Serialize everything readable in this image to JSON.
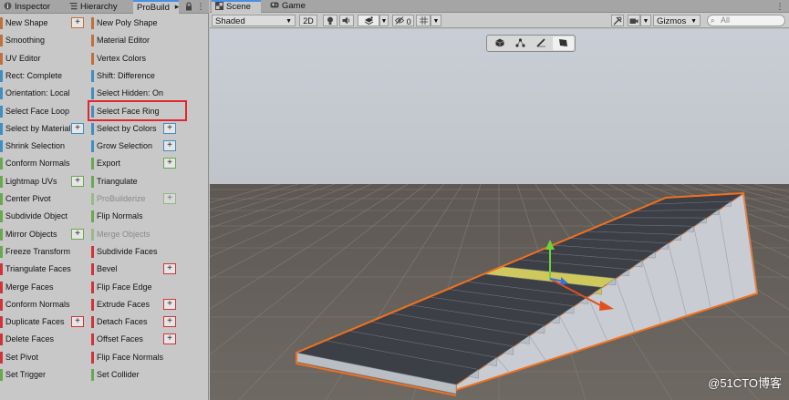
{
  "left_tabs": [
    {
      "label": "Inspector"
    },
    {
      "label": "Hierarchy"
    },
    {
      "label": "ProBuild"
    }
  ],
  "probuilder": {
    "left_column": [
      {
        "label": "New Shape",
        "color": "#c0703a",
        "plus": true
      },
      {
        "label": "Smoothing",
        "color": "#c0703a",
        "plus": false
      },
      {
        "label": "UV Editor",
        "color": "#c0703a",
        "plus": false
      },
      {
        "label": "Rect: Complete",
        "color": "#3f8fc0",
        "plus": false
      },
      {
        "label": "Orientation: Local",
        "color": "#3f8fc0",
        "plus": false
      },
      {
        "label": "Select Face Loop",
        "color": "#3f8fc0",
        "plus": false
      },
      {
        "label": "Select by Material",
        "color": "#3f8fc0",
        "plus": true
      },
      {
        "label": "Shrink Selection",
        "color": "#3f8fc0",
        "plus": false
      },
      {
        "label": "Conform Normals",
        "color": "#6aa84f",
        "plus": false
      },
      {
        "label": "Lightmap UVs",
        "color": "#6aa84f",
        "plus": true
      },
      {
        "label": "Center Pivot",
        "color": "#6aa84f",
        "plus": false
      },
      {
        "label": "Subdivide Object",
        "color": "#6aa84f",
        "plus": false
      },
      {
        "label": "Mirror Objects",
        "color": "#6aa84f",
        "plus": true
      },
      {
        "label": "Freeze Transform",
        "color": "#6aa84f",
        "plus": false
      },
      {
        "label": "Triangulate Faces",
        "color": "#d0343a",
        "plus": false
      },
      {
        "label": "Merge Faces",
        "color": "#d0343a",
        "plus": false
      },
      {
        "label": "Conform Normals",
        "color": "#d0343a",
        "plus": false
      },
      {
        "label": "Duplicate Faces",
        "color": "#d0343a",
        "plus": true
      },
      {
        "label": "Delete Faces",
        "color": "#d0343a",
        "plus": false
      },
      {
        "label": "Set Pivot",
        "color": "#d0343a",
        "plus": false
      },
      {
        "label": "Set Trigger",
        "color": "#6aa84f",
        "plus": false
      }
    ],
    "right_column": [
      {
        "label": "New Poly Shape",
        "color": "#c0703a",
        "plus": false
      },
      {
        "label": "Material Editor",
        "color": "#c0703a",
        "plus": false
      },
      {
        "label": "Vertex Colors",
        "color": "#c0703a",
        "plus": false
      },
      {
        "label": "Shift: Difference",
        "color": "#3f8fc0",
        "plus": false
      },
      {
        "label": "Select Hidden: On",
        "color": "#3f8fc0",
        "plus": false
      },
      {
        "label": "Select Face Ring",
        "color": "#3f8fc0",
        "plus": false
      },
      {
        "label": "Select by Colors",
        "color": "#3f8fc0",
        "plus": true
      },
      {
        "label": "Grow Selection",
        "color": "#3f8fc0",
        "plus": true
      },
      {
        "label": "Export",
        "color": "#6aa84f",
        "plus": true
      },
      {
        "label": "Triangulate",
        "color": "#6aa84f",
        "plus": false
      },
      {
        "label": "ProBuilderize",
        "color": "#6aa84f",
        "plus": true,
        "disabled": true
      },
      {
        "label": "Flip Normals",
        "color": "#6aa84f",
        "plus": false
      },
      {
        "label": "Merge Objects",
        "color": "#6aa84f",
        "plus": false,
        "disabled": true
      },
      {
        "label": "Subdivide Faces",
        "color": "#d0343a",
        "plus": false
      },
      {
        "label": "Bevel",
        "color": "#d0343a",
        "plus": true
      },
      {
        "label": "Flip Face Edge",
        "color": "#d0343a",
        "plus": false
      },
      {
        "label": "Extrude Faces",
        "color": "#d0343a",
        "plus": true
      },
      {
        "label": "Detach Faces",
        "color": "#d0343a",
        "plus": true
      },
      {
        "label": "Offset Faces",
        "color": "#d0343a",
        "plus": true
      },
      {
        "label": "Flip Face Normals",
        "color": "#d0343a",
        "plus": false
      },
      {
        "label": "Set Collider",
        "color": "#6aa84f",
        "plus": false
      }
    ]
  },
  "scene_tabs": [
    {
      "label": "Scene"
    },
    {
      "label": "Game"
    }
  ],
  "scene_toolbar": {
    "draw_mode": "Shaded",
    "mode_2d": "2D",
    "hidden_count": "0",
    "gizmos": "Gizmos",
    "search_placeholder": "All"
  },
  "watermark": "@51CTO博客",
  "colors": {
    "orange": "#c0703a",
    "blue": "#3f8fc0",
    "green": "#6aa84f",
    "red": "#d0343a",
    "highlight": "#e3262b",
    "selection": "#f07020"
  }
}
